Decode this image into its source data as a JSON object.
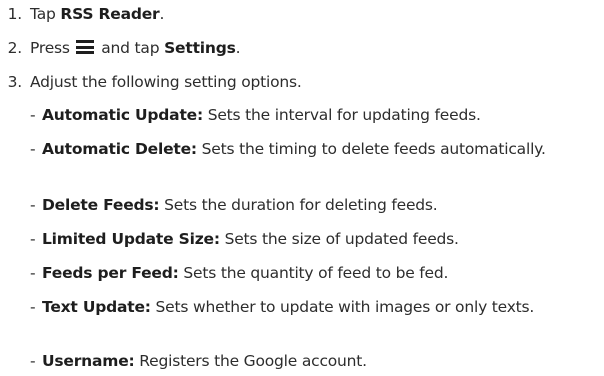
{
  "steps": [
    {
      "num": "1.",
      "pre": "Tap ",
      "bold": "RSS Reader",
      "post": "."
    },
    {
      "num": "2.",
      "pre": "Press ",
      "icon": "menu-icon",
      "mid": " and tap ",
      "bold": "Settings",
      "post": "."
    },
    {
      "num": "3.",
      "text": "Adjust the following setting options."
    }
  ],
  "options": [
    {
      "dash": "-",
      "label": "Automatic Update:",
      "desc": " Sets the interval for updating feeds."
    },
    {
      "dash": "-",
      "label": "Automatic Delete:",
      "desc": " Sets the timing to delete feeds automatically."
    },
    {
      "dash": "-",
      "label": "Delete Feeds:",
      "desc": " Sets the duration for deleting feeds."
    },
    {
      "dash": "-",
      "label": "Limited Update Size:",
      "desc": " Sets the size of updated feeds."
    },
    {
      "dash": "-",
      "label": "Feeds per Feed:",
      "desc": " Sets the quantity of feed to be fed."
    },
    {
      "dash": "-",
      "label": "Text Update:",
      "desc": " Sets whether to update with images or only texts."
    },
    {
      "dash": "-",
      "label": "Username:",
      "desc": " Registers the Google account."
    }
  ]
}
